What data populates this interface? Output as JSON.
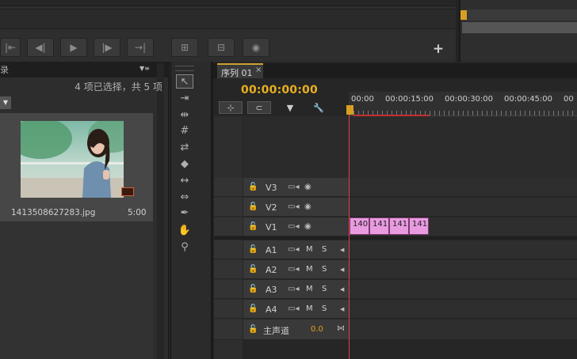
{
  "project": {
    "tab_label": "录",
    "selection_info": "4 项已选择，共 5 项",
    "clip": {
      "name": "1413508627283.jpg",
      "duration": "5:00"
    }
  },
  "icons": {
    "transport": [
      "step-back-icon",
      "step-frame-back-icon",
      "play-icon",
      "step-frame-forward-icon",
      "step-forward-icon",
      "insert-icon",
      "overwrite-icon",
      "export-frame-icon"
    ],
    "tools": [
      "selection-icon",
      "track-select-icon",
      "ripple-edit-icon",
      "rolling-edit-icon",
      "rate-stretch-icon",
      "razor-icon",
      "slip-icon",
      "slide-icon",
      "pen-icon",
      "hand-icon",
      "zoom-icon"
    ]
  },
  "timeline": {
    "tab_label": "序列 01",
    "close": "×",
    "timecode": "00:00:00:00",
    "ruler": [
      "00:00",
      "00:00:15:00",
      "00:00:30:00",
      "00:00:45:00",
      "00"
    ],
    "video_tracks": [
      {
        "name": "V3"
      },
      {
        "name": "V2"
      },
      {
        "name": "V1"
      }
    ],
    "audio_tracks": [
      {
        "name": "A1",
        "m": "M",
        "s": "S"
      },
      {
        "name": "A2",
        "m": "M",
        "s": "S"
      },
      {
        "name": "A3",
        "m": "M",
        "s": "S"
      },
      {
        "name": "A4",
        "m": "M",
        "s": "S"
      }
    ],
    "master": {
      "name": "主声道",
      "value": "0.0"
    },
    "clips": [
      "140",
      "141",
      "141",
      "141"
    ]
  },
  "colors": {
    "timecode": "#e8b020",
    "clip": "#e99be0",
    "playhead": "#e04040"
  }
}
